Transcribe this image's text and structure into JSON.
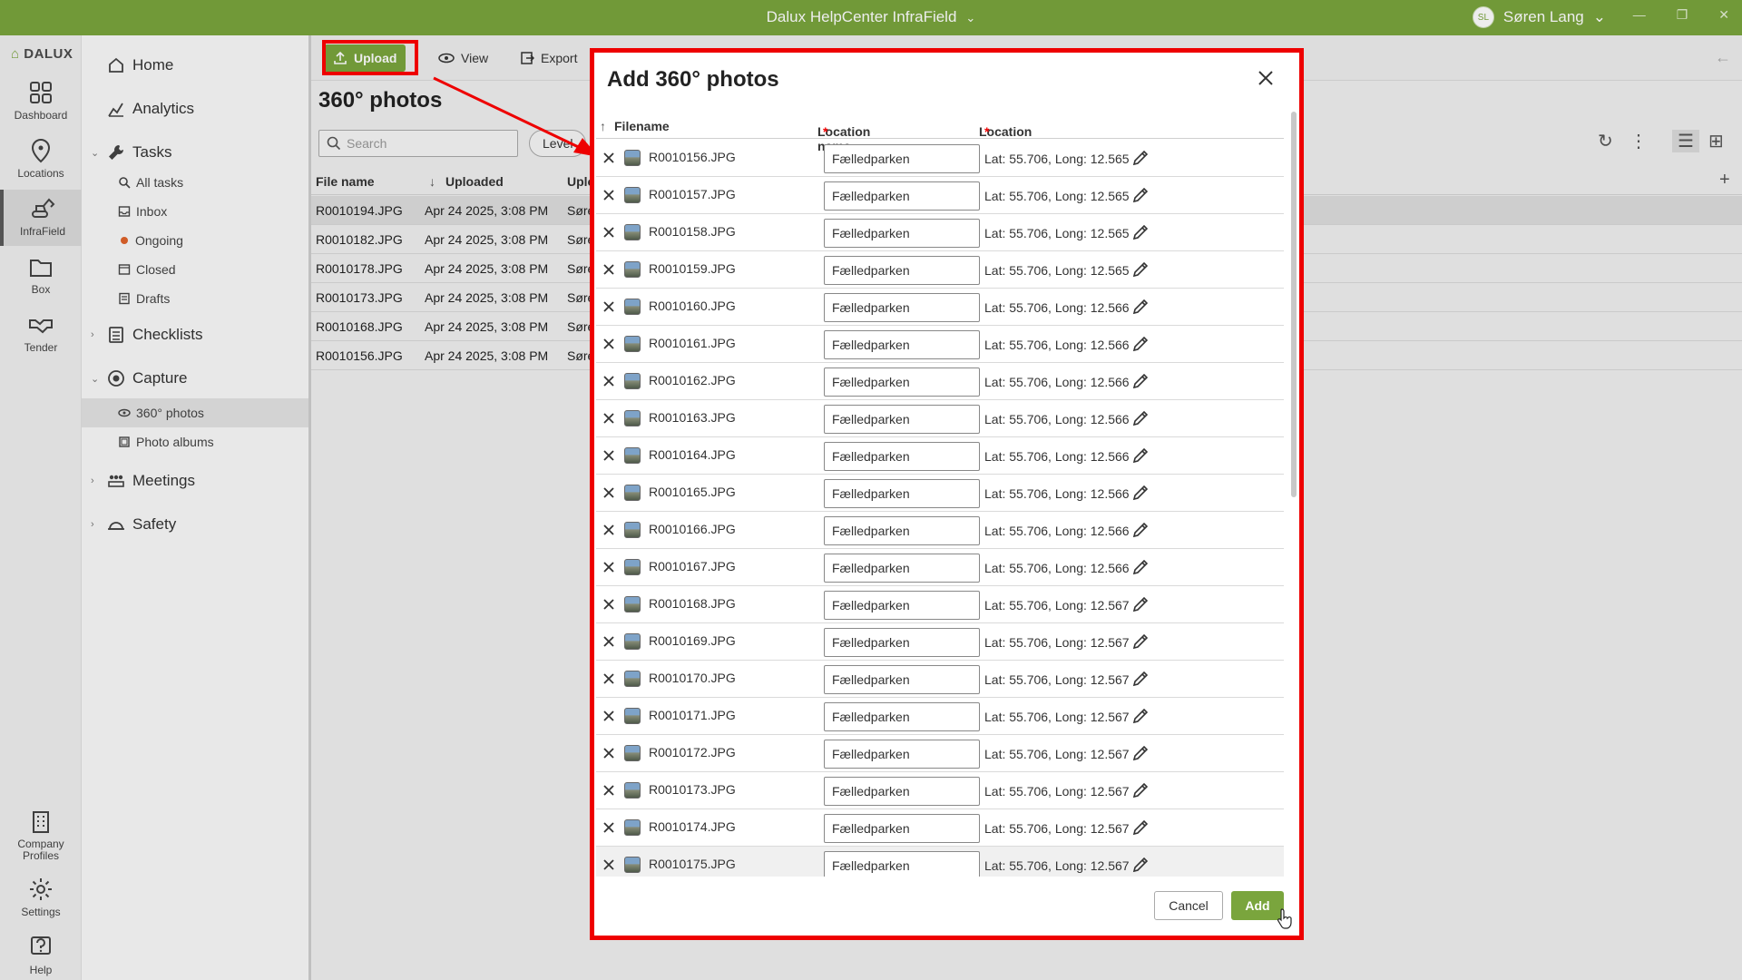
{
  "titlebar": {
    "title": "Dalux HelpCenter InfraField",
    "user_initials": "SL",
    "user_name": "Søren Lang"
  },
  "rail": {
    "logo": "DALUX",
    "items": [
      {
        "label": "Dashboard",
        "icon": "grid-icon"
      },
      {
        "label": "Locations",
        "icon": "map-pin-icon"
      },
      {
        "label": "InfraField",
        "icon": "excavator-icon"
      },
      {
        "label": "Box",
        "icon": "folder-icon"
      },
      {
        "label": "Tender",
        "icon": "handshake-icon"
      }
    ],
    "bottom_items": [
      {
        "label_line1": "Company",
        "label_line2": "Profiles",
        "icon": "building-icon"
      },
      {
        "label": "Settings",
        "icon": "gear-icon"
      },
      {
        "label": "Help",
        "icon": "help-icon"
      }
    ]
  },
  "sidebar": {
    "home": "Home",
    "analytics": "Analytics",
    "tasks": "Tasks",
    "tasks_sub": [
      "All tasks",
      "Inbox",
      "Ongoing",
      "Closed",
      "Drafts"
    ],
    "checklists": "Checklists",
    "capture": "Capture",
    "capture_sub": [
      "360° photos",
      "Photo albums"
    ],
    "meetings": "Meetings",
    "safety": "Safety"
  },
  "toolbar": {
    "upload": "Upload",
    "view": "View",
    "export": "Export"
  },
  "page": {
    "title": "360° photos",
    "search_placeholder": "Search",
    "level_filter": "Level",
    "columns": {
      "file_name": "File name",
      "uploaded": "Uploaded",
      "uploaded_by": "Uplo"
    },
    "rows": [
      {
        "file": "R0010194.JPG",
        "uploaded": "Apr 24 2025, 3:08 PM",
        "by": "Søre"
      },
      {
        "file": "R0010182.JPG",
        "uploaded": "Apr 24 2025, 3:08 PM",
        "by": "Søre"
      },
      {
        "file": "R0010178.JPG",
        "uploaded": "Apr 24 2025, 3:08 PM",
        "by": "Søre"
      },
      {
        "file": "R0010173.JPG",
        "uploaded": "Apr 24 2025, 3:08 PM",
        "by": "Søre"
      },
      {
        "file": "R0010168.JPG",
        "uploaded": "Apr 24 2025, 3:08 PM",
        "by": "Søre"
      },
      {
        "file": "R0010156.JPG",
        "uploaded": "Apr 24 2025, 3:08 PM",
        "by": "Søre"
      }
    ]
  },
  "modal": {
    "title": "Add 360° photos",
    "col_filename": "Filename",
    "col_location_name": "Location name",
    "col_location": "Location",
    "required_mark": "*",
    "rows": [
      {
        "file": "R0010156.JPG",
        "location_name": "Fælledparken",
        "location": "Lat: 55.706, Long: 12.565"
      },
      {
        "file": "R0010157.JPG",
        "location_name": "Fælledparken",
        "location": "Lat: 55.706, Long: 12.565"
      },
      {
        "file": "R0010158.JPG",
        "location_name": "Fælledparken",
        "location": "Lat: 55.706, Long: 12.565"
      },
      {
        "file": "R0010159.JPG",
        "location_name": "Fælledparken",
        "location": "Lat: 55.706, Long: 12.565"
      },
      {
        "file": "R0010160.JPG",
        "location_name": "Fælledparken",
        "location": "Lat: 55.706, Long: 12.566"
      },
      {
        "file": "R0010161.JPG",
        "location_name": "Fælledparken",
        "location": "Lat: 55.706, Long: 12.566"
      },
      {
        "file": "R0010162.JPG",
        "location_name": "Fælledparken",
        "location": "Lat: 55.706, Long: 12.566"
      },
      {
        "file": "R0010163.JPG",
        "location_name": "Fælledparken",
        "location": "Lat: 55.706, Long: 12.566"
      },
      {
        "file": "R0010164.JPG",
        "location_name": "Fælledparken",
        "location": "Lat: 55.706, Long: 12.566"
      },
      {
        "file": "R0010165.JPG",
        "location_name": "Fælledparken",
        "location": "Lat: 55.706, Long: 12.566"
      },
      {
        "file": "R0010166.JPG",
        "location_name": "Fælledparken",
        "location": "Lat: 55.706, Long: 12.566"
      },
      {
        "file": "R0010167.JPG",
        "location_name": "Fælledparken",
        "location": "Lat: 55.706, Long: 12.566"
      },
      {
        "file": "R0010168.JPG",
        "location_name": "Fælledparken",
        "location": "Lat: 55.706, Long: 12.567"
      },
      {
        "file": "R0010169.JPG",
        "location_name": "Fælledparken",
        "location": "Lat: 55.706, Long: 12.567"
      },
      {
        "file": "R0010170.JPG",
        "location_name": "Fælledparken",
        "location": "Lat: 55.706, Long: 12.567"
      },
      {
        "file": "R0010171.JPG",
        "location_name": "Fælledparken",
        "location": "Lat: 55.706, Long: 12.567"
      },
      {
        "file": "R0010172.JPG",
        "location_name": "Fælledparken",
        "location": "Lat: 55.706, Long: 12.567"
      },
      {
        "file": "R0010173.JPG",
        "location_name": "Fælledparken",
        "location": "Lat: 55.706, Long: 12.567"
      },
      {
        "file": "R0010174.JPG",
        "location_name": "Fælledparken",
        "location": "Lat: 55.706, Long: 12.567"
      },
      {
        "file": "R0010175.JPG",
        "location_name": "Fælledparken",
        "location": "Lat: 55.706, Long: 12.567"
      }
    ],
    "cancel": "Cancel",
    "add": "Add"
  },
  "colors": {
    "brand_green": "#7aa53d",
    "highlight_red": "#ee0000"
  }
}
